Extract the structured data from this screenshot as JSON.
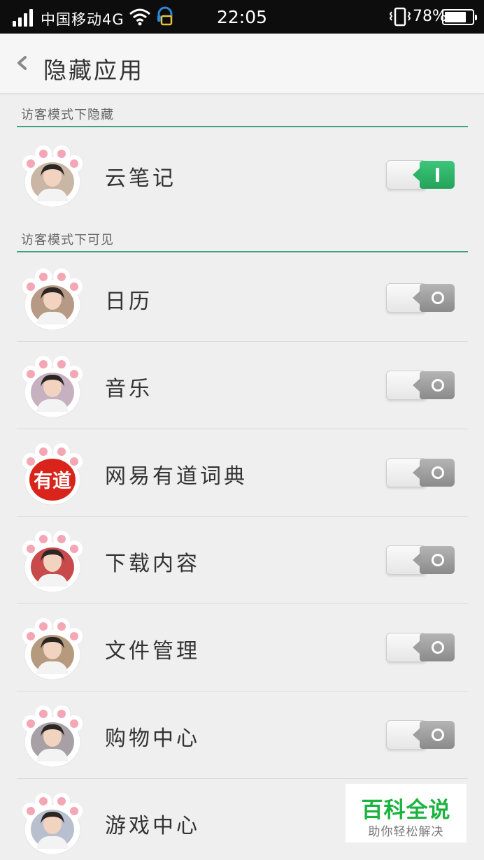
{
  "status_bar": {
    "carrier": "中国移动4G",
    "time": "22:05",
    "battery_percent": "78%",
    "battery_level": 0.78,
    "icons": [
      "signal-icon",
      "wifi-icon",
      "headset-icon",
      "vibrate-icon",
      "battery-icon"
    ]
  },
  "header": {
    "back_icon": "chevron-left-icon",
    "title": "隐藏应用"
  },
  "sections": [
    {
      "title": "访客模式下隐藏",
      "apps": [
        {
          "label": "云笔记",
          "enabled": true,
          "avatar_bg": "#c9b6a4"
        }
      ]
    },
    {
      "title": "访客模式下可见",
      "apps": [
        {
          "label": "日历",
          "enabled": false,
          "avatar_bg": "#b79a86"
        },
        {
          "label": "音乐",
          "enabled": false,
          "avatar_bg": "#c5b1bf"
        },
        {
          "label": "网易有道词典",
          "enabled": false,
          "logo_text": "有道",
          "logo_color": "#d9241c"
        },
        {
          "label": "下载内容",
          "enabled": false,
          "avatar_bg": "#c84a4a"
        },
        {
          "label": "文件管理",
          "enabled": false,
          "avatar_bg": "#b59a7d"
        },
        {
          "label": "购物中心",
          "enabled": false,
          "avatar_bg": "#a7a1a6"
        },
        {
          "label": "游戏中心",
          "enabled": false,
          "avatar_bg": "#b8c0d0"
        }
      ]
    }
  ],
  "watermark": {
    "title": "百科全说",
    "subtitle": "助你轻松解决"
  },
  "colors": {
    "accent_green": "#3aa477",
    "toggle_on": "#2db367",
    "toggle_off": "#9e9e9e",
    "paw_pink": "#f4a6b4"
  }
}
